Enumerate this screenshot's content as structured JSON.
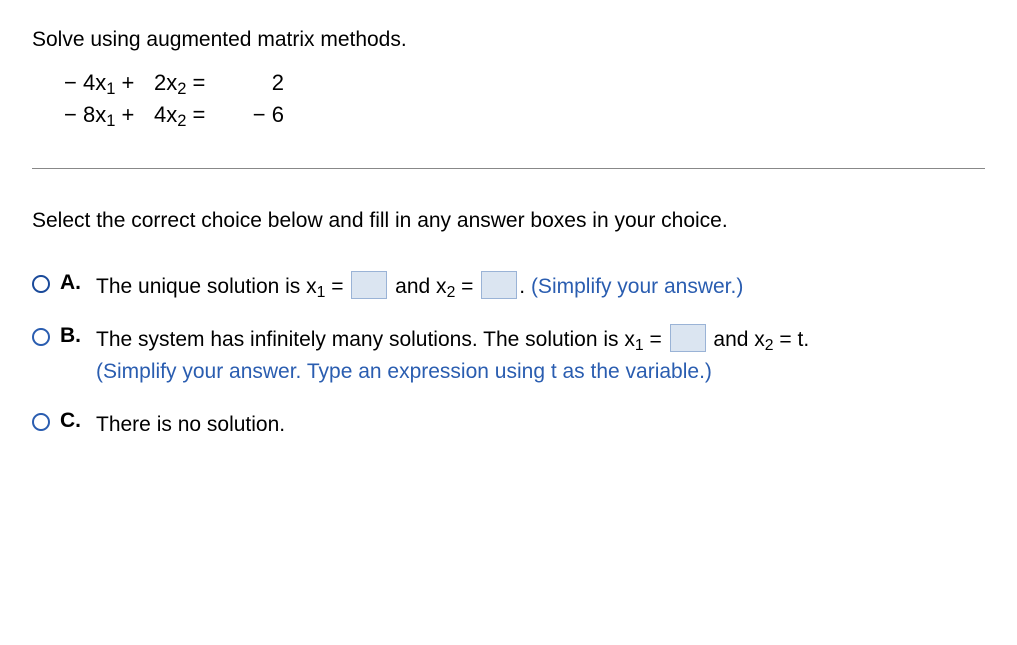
{
  "problem": {
    "statement": "Solve using augmented matrix methods.",
    "equations": [
      {
        "term1_prefix": "− 4x",
        "term1_sub": "1",
        "plus": " + ",
        "term2_prefix": "2x",
        "term2_sub": "2",
        "eq": " = ",
        "rhs": "2"
      },
      {
        "term1_prefix": "− 8x",
        "term1_sub": "1",
        "plus": " + ",
        "term2_prefix": "4x",
        "term2_sub": "2",
        "eq": " = ",
        "rhs": "− 6"
      }
    ]
  },
  "instructions": "Select the correct choice below and fill in any answer boxes in your choice.",
  "choices": {
    "A": {
      "label": "A.",
      "text_1": "The unique solution is x",
      "sub_1": "1",
      "text_2": " = ",
      "text_3": " and x",
      "sub_2": "2",
      "text_4": " = ",
      "text_5": ". ",
      "hint": "(Simplify your answer.)"
    },
    "B": {
      "label": "B.",
      "text_1": "The system has infinitely many solutions. The solution is x",
      "sub_1": "1",
      "text_2": " = ",
      "text_3": " and x",
      "sub_2": "2",
      "text_4": " = t.",
      "hint": "(Simplify your answer. Type an expression using t as the variable.)"
    },
    "C": {
      "label": "C.",
      "text_1": "There is no solution."
    }
  }
}
